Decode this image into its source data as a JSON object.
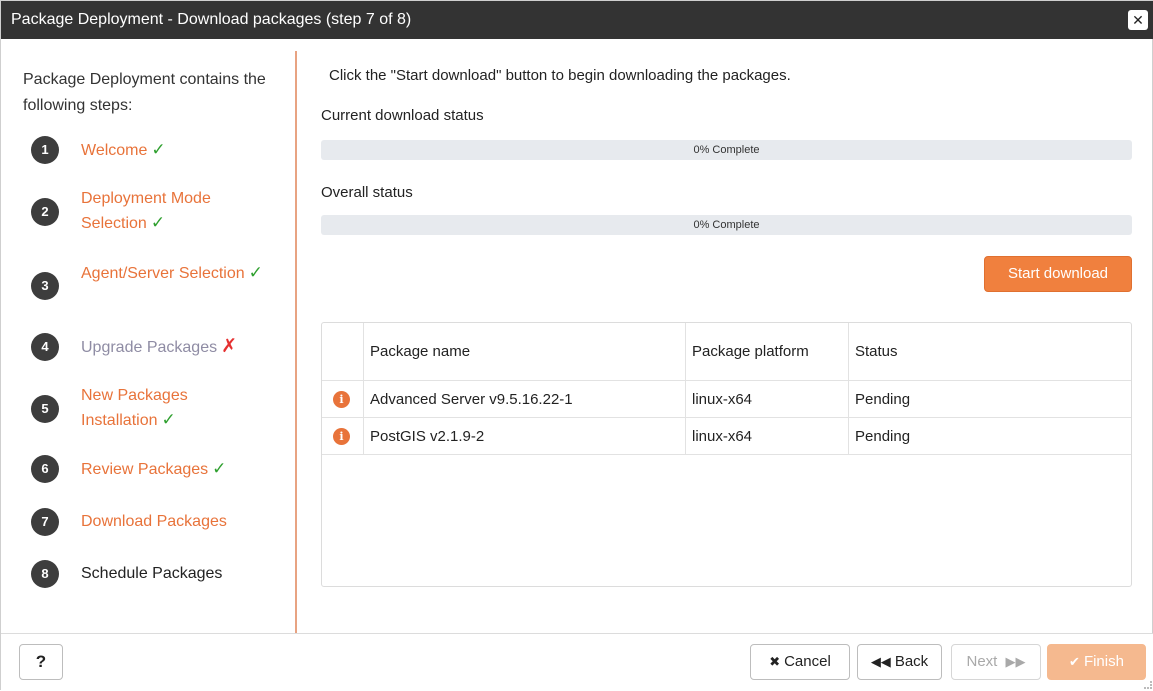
{
  "window": {
    "title": "Package Deployment - Download packages (step 7 of 8)",
    "close_icon": "close-icon"
  },
  "sidebar": {
    "intro": "Package Deployment contains the following steps:",
    "steps": [
      {
        "num": "1",
        "label": "Welcome",
        "state": "done",
        "color": "orange"
      },
      {
        "num": "2",
        "label": "Deployment Mode Selection",
        "state": "done",
        "color": "orange"
      },
      {
        "num": "3",
        "label": "Agent/Server Selection",
        "state": "done",
        "color": "orange"
      },
      {
        "num": "4",
        "label": "Upgrade Packages",
        "state": "failed",
        "color": "grayish"
      },
      {
        "num": "5",
        "label": "New Packages Installation",
        "state": "done",
        "color": "orange"
      },
      {
        "num": "6",
        "label": "Review Packages",
        "state": "done",
        "color": "orange"
      },
      {
        "num": "7",
        "label": "Download Packages",
        "state": "current",
        "color": "orange"
      },
      {
        "num": "8",
        "label": "Schedule Packages",
        "state": "pending",
        "color": "dark"
      }
    ],
    "tick_glyph": "✓",
    "cross_glyph": "✗"
  },
  "main": {
    "instructions": "Click the \"Start download\" button to begin downloading the packages.",
    "current_status_label": "Current download status",
    "current_progress": {
      "text": "0% Complete",
      "fraction": 0
    },
    "overall_status_label": "Overall status",
    "overall_progress": {
      "text": "0% Complete",
      "fraction": 0
    },
    "start_button": "Start download"
  },
  "table": {
    "columns": [
      "",
      "Package name",
      "Package platform",
      "Status"
    ],
    "rows": [
      {
        "icon": "info-icon",
        "name": "Advanced Server v9.5.16.22-1",
        "platform": "linux-x64",
        "status": "Pending"
      },
      {
        "icon": "info-icon",
        "name": "PostGIS v2.1.9-2",
        "platform": "linux-x64",
        "status": "Pending"
      }
    ]
  },
  "footer": {
    "help": "?",
    "cancel": "Cancel",
    "back": "Back",
    "next": "Next",
    "finish": "Finish"
  },
  "colors": {
    "accent": "#e8733a",
    "titlebar": "#333333",
    "success": "#2fa02f",
    "error": "#e53030"
  }
}
